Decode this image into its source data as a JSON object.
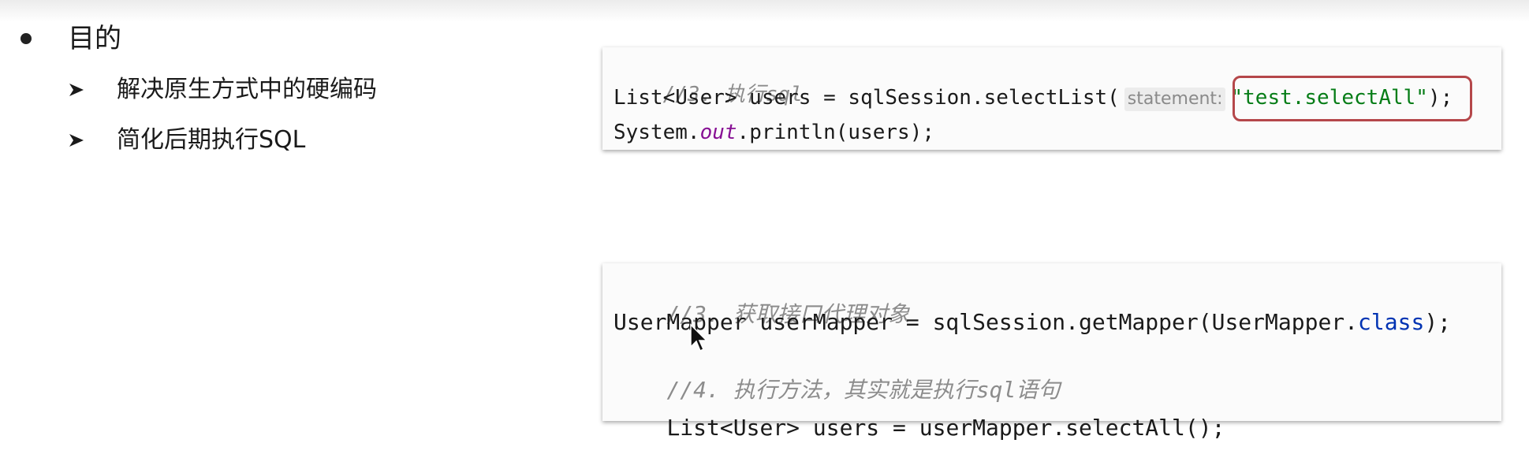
{
  "heading": "目的",
  "bullets": [
    "解决原生方式中的硬编码",
    "简化后期执行SQL"
  ],
  "code_block_1": {
    "comment": "//3. 执行sql",
    "line2_prefix": "List<User> users = sqlSession.selectList(",
    "param_hint": "statement:",
    "string_literal": "\"test.selectAll\"",
    "line2_suffix": ");",
    "line3_prefix": "System.",
    "line3_field": "out",
    "line3_suffix": ".println(users);"
  },
  "code_block_2": {
    "comment1": "//3. 获取接口代理对象",
    "line2_prefix": "UserMapper userMapper = sqlSession.getMapper(UserMapper.",
    "line2_keyword": "class",
    "line2_suffix": ");",
    "comment2": "//4. 执行方法，其实就是执行sql语句",
    "line4": "List<User> users = userMapper.selectAll();"
  },
  "colors": {
    "comment": "#8c8c8c",
    "string": "#067d17",
    "keyword": "#0033b3",
    "static_field": "#871094",
    "highlight_border": "#b5474a"
  }
}
